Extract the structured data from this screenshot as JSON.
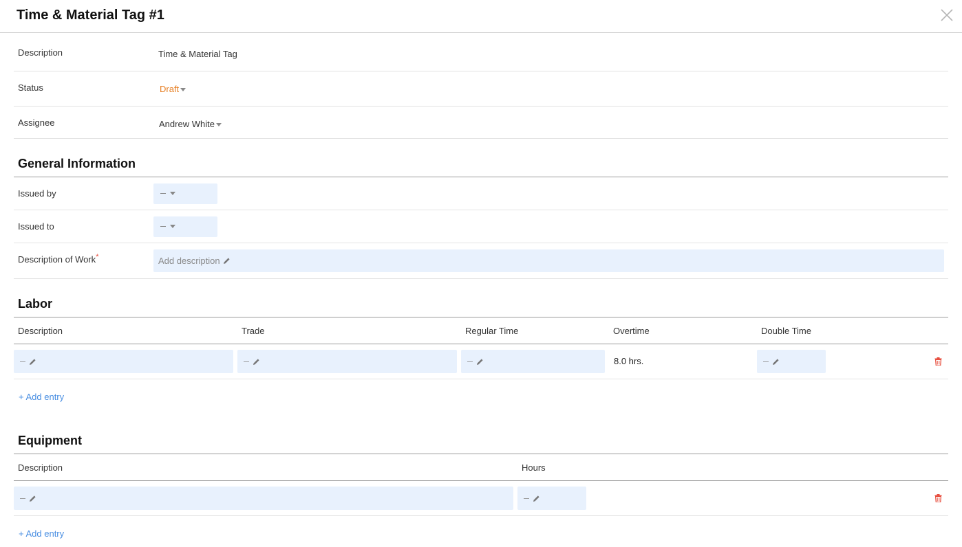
{
  "header": {
    "title": "Time & Material Tag #1"
  },
  "details": {
    "description_label": "Description",
    "description_value": "Time & Material Tag",
    "status_label": "Status",
    "status_value": "Draft",
    "assignee_label": "Assignee",
    "assignee_value": "Andrew White"
  },
  "general_information": {
    "title": "General Information",
    "issued_by_label": "Issued by",
    "issued_to_label": "Issued to",
    "description_of_work_label": "Description of Work",
    "required_mark": "*",
    "description_of_work_placeholder": "Add description"
  },
  "labor": {
    "title": "Labor",
    "columns": [
      "Description",
      "Trade",
      "Regular Time",
      "Overtime",
      "Double Time"
    ],
    "rows": [
      {
        "overtime": "8.0  hrs."
      }
    ],
    "add_entry_label": "+ Add entry"
  },
  "equipment": {
    "title": "Equipment",
    "columns": [
      "Description",
      "Hours"
    ],
    "add_entry_label": "+ Add entry"
  },
  "colors": {
    "status_draft": "#e67e22",
    "field_bg": "#e8f1fd",
    "link": "#4a8fe2",
    "delete": "#e74c3c"
  },
  "icons": [
    "close-icon",
    "chevron-down-icon",
    "pencil-icon",
    "trash-icon"
  ]
}
